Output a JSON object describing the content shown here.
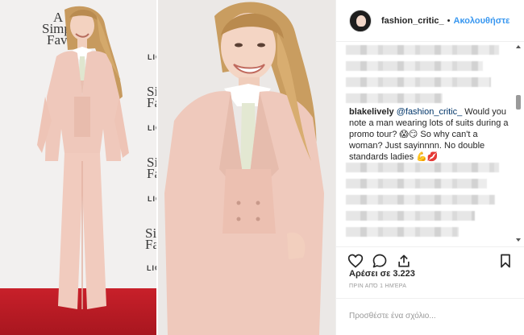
{
  "post": {
    "backdrop_left": [
      "A",
      "Simple",
      "Favor"
    ],
    "backdrop_mid1": [
      "Simpl",
      "Fav"
    ],
    "backdrop_mid2": [
      "Simple",
      "Favor"
    ],
    "backdrop_mid3": [
      "Simple",
      "Favor"
    ],
    "logo_fragment": "LIO",
    "logo_fragment_short": "LIG"
  },
  "header": {
    "username": "fashion_critic_",
    "separator": "•",
    "follow_label": "Ακολουθήστε",
    "avatar_icon": "profile-avatar"
  },
  "comment": {
    "author": "blakelively",
    "mention": "@fashion_critic_",
    "text_1": " Would you note a man wearing lots of suits during a promo tour? ",
    "emoji_1": "😱😏",
    "text_2": " So why can't a woman? Just sayinnnn. No double standards ladies ",
    "emoji_2": "💪💋"
  },
  "actions": {
    "like_icon": "heart-icon",
    "comment_icon": "comment-icon",
    "share_icon": "share-icon",
    "save_icon": "bookmark-icon"
  },
  "likes_label": "Αρέσει σε 3.223",
  "timestamp": "ΠΡΙΝ ΑΠΌ 1 ΗΜΈΡΑ",
  "comment_placeholder": "Προσθέστε ένα σχόλιο...",
  "colors": {
    "link_blue": "#3897f0",
    "suit_pink": "#efc8bb",
    "carpet_red": "#c8202a"
  }
}
